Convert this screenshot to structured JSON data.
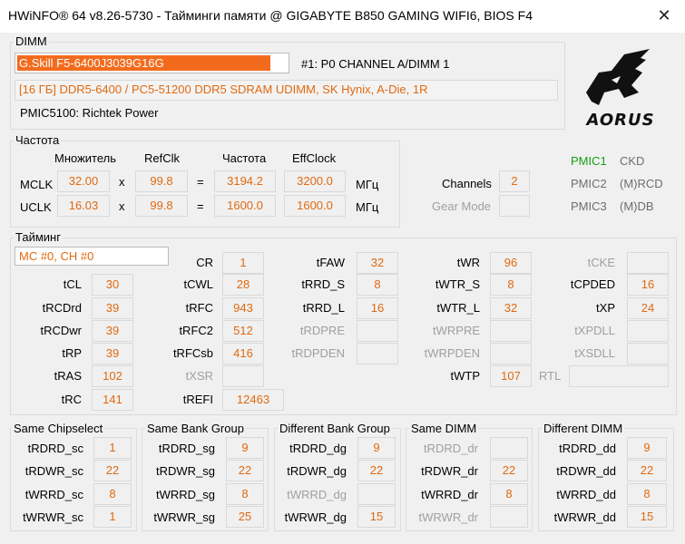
{
  "window": {
    "title": "HWiNFO® 64 v8.26-5730 - Тайминги памяти @ GIGABYTE B850 GAMING WIFI6, BIOS F4",
    "close": "✕"
  },
  "dimm": {
    "legend": "DIMM",
    "selected_module": "G.Skill F5-6400J3039G16G",
    "slot": "#1: P0 CHANNEL A/DIMM 1",
    "description": "[16 ГБ] DDR5-6400 / PC5-51200 DDR5 SDRAM UDIMM, SK Hynix, A-Die, 1R",
    "pmic": "PMIC5100: Richtek Power",
    "logo_text": "AORUS"
  },
  "freq": {
    "legend": "Частота",
    "headers": {
      "mult": "Множитель",
      "refclk": "RefClk",
      "freq": "Частота",
      "eff": "EffClock"
    },
    "mclk": {
      "label": "MCLK",
      "mult": "32.00",
      "x": "x",
      "refclk": "99.8",
      "eq": "=",
      "freq": "3194.2",
      "eff": "3200.0",
      "unit": "МГц"
    },
    "uclk": {
      "label": "UCLK",
      "mult": "16.03",
      "x": "x",
      "refclk": "99.8",
      "eq": "=",
      "freq": "1600.0",
      "eff": "1600.0",
      "unit": "МГц"
    },
    "channels": {
      "label": "Channels",
      "value": "2"
    },
    "gear_mode": {
      "label": "Gear Mode",
      "value": ""
    }
  },
  "pmic_list": [
    {
      "name": "PMIC1",
      "type": "CKD"
    },
    {
      "name": "PMIC2",
      "type": "(M)RCD"
    },
    {
      "name": "PMIC3",
      "type": "(M)DB"
    }
  ],
  "timing": {
    "legend": "Тайминг",
    "channel_select": "MC #0, CH #0",
    "tCL": {
      "label": "tCL",
      "value": "30"
    },
    "tRCDrd": {
      "label": "tRCDrd",
      "value": "39"
    },
    "tRCDwr": {
      "label": "tRCDwr",
      "value": "39"
    },
    "tRP": {
      "label": "tRP",
      "value": "39"
    },
    "tRAS": {
      "label": "tRAS",
      "value": "102"
    },
    "tRC": {
      "label": "tRC",
      "value": "141"
    },
    "CR": {
      "label": "CR",
      "value": "1"
    },
    "tCWL": {
      "label": "tCWL",
      "value": "28"
    },
    "tRFC": {
      "label": "tRFC",
      "value": "943"
    },
    "tRFC2": {
      "label": "tRFC2",
      "value": "512"
    },
    "tRFCsb": {
      "label": "tRFCsb",
      "value": "416"
    },
    "tXSR": {
      "label": "tXSR",
      "value": ""
    },
    "tREFI": {
      "label": "tREFI",
      "value": "12463"
    },
    "tFAW": {
      "label": "tFAW",
      "value": "32"
    },
    "tRRD_S": {
      "label": "tRRD_S",
      "value": "8"
    },
    "tRRD_L": {
      "label": "tRRD_L",
      "value": "16"
    },
    "tRDPRE": {
      "label": "tRDPRE",
      "value": ""
    },
    "tRDPDEN": {
      "label": "tRDPDEN",
      "value": ""
    },
    "tWR": {
      "label": "tWR",
      "value": "96"
    },
    "tWTR_S": {
      "label": "tWTR_S",
      "value": "8"
    },
    "tWTR_L": {
      "label": "tWTR_L",
      "value": "32"
    },
    "tWRPRE": {
      "label": "tWRPRE",
      "value": ""
    },
    "tWRPDEN": {
      "label": "tWRPDEN",
      "value": ""
    },
    "tWTP": {
      "label": "tWTP",
      "value": "107"
    },
    "tCKE": {
      "label": "tCKE",
      "value": ""
    },
    "tCPDED": {
      "label": "tCPDED",
      "value": "16"
    },
    "tXP": {
      "label": "tXP",
      "value": "24"
    },
    "tXPDLL": {
      "label": "tXPDLL",
      "value": ""
    },
    "tXSDLL": {
      "label": "tXSDLL",
      "value": ""
    },
    "RTL": {
      "label": "RTL",
      "value": ""
    }
  },
  "groups": [
    {
      "title": "Same Chipselect",
      "rows": [
        {
          "label": "tRDRD_sc",
          "value": "1"
        },
        {
          "label": "tRDWR_sc",
          "value": "22"
        },
        {
          "label": "tWRRD_sc",
          "value": "8"
        },
        {
          "label": "tWRWR_sc",
          "value": "1"
        }
      ]
    },
    {
      "title": "Same Bank Group",
      "rows": [
        {
          "label": "tRDRD_sg",
          "value": "9"
        },
        {
          "label": "tRDWR_sg",
          "value": "22"
        },
        {
          "label": "tWRRD_sg",
          "value": "8"
        },
        {
          "label": "tWRWR_sg",
          "value": "25"
        }
      ]
    },
    {
      "title": "Different Bank Group",
      "rows": [
        {
          "label": "tRDRD_dg",
          "value": "9"
        },
        {
          "label": "tRDWR_dg",
          "value": "22"
        },
        {
          "label": "tWRRD_dg",
          "value": ""
        },
        {
          "label": "tWRWR_dg",
          "value": "15"
        }
      ]
    },
    {
      "title": "Same DIMM",
      "rows": [
        {
          "label": "tRDRD_dr",
          "value": ""
        },
        {
          "label": "tRDWR_dr",
          "value": "22"
        },
        {
          "label": "tWRRD_dr",
          "value": "8"
        },
        {
          "label": "tWRWR_dr",
          "value": ""
        }
      ]
    },
    {
      "title": "Different DIMM",
      "rows": [
        {
          "label": "tRDRD_dd",
          "value": "9"
        },
        {
          "label": "tRDWR_dd",
          "value": "22"
        },
        {
          "label": "tWRRD_dd",
          "value": "8"
        },
        {
          "label": "tWRWR_dd",
          "value": "15"
        }
      ]
    }
  ],
  "colors": {
    "value": "#e06a10",
    "pmic_active": "#16a016",
    "selection": "#f26b1d",
    "inactive": "#a0a0a0"
  }
}
